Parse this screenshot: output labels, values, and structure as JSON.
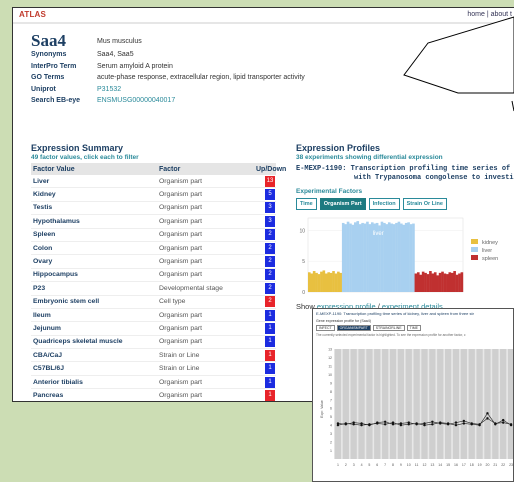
{
  "header": {
    "logo": "ATLAS",
    "nav": "home | about t"
  },
  "gene": {
    "name": "Saa4",
    "species": "Mus musculus",
    "props": [
      {
        "key": "Synonyms",
        "value": "Saa4, Saa5",
        "link": false
      },
      {
        "key": "InterPro Term",
        "value": "Serum amyloid A protein",
        "link": false
      },
      {
        "key": "GO Terms",
        "value": "acute-phase response, extracellular region, lipid transporter activity",
        "link": false
      },
      {
        "key": "Uniprot",
        "value": "P31532",
        "link": true
      },
      {
        "key": "Search EB-eye",
        "value": "ENSMUSG00000040017",
        "link": true
      }
    ]
  },
  "summary": {
    "title": "Expression Summary",
    "subtitle": "49 factor values, click each to filter",
    "headers": {
      "factor_value": "Factor Value",
      "factor": "Factor",
      "updown": "Up/Down"
    },
    "rows": [
      {
        "fv": "Liver",
        "factor": "Organism part",
        "count": "13",
        "dir": "up"
      },
      {
        "fv": "Kidney",
        "factor": "Organism part",
        "count": "5",
        "dir": "down"
      },
      {
        "fv": "Testis",
        "factor": "Organism part",
        "count": "3",
        "dir": "down"
      },
      {
        "fv": "Hypothalamus",
        "factor": "Organism part",
        "count": "3",
        "dir": "down"
      },
      {
        "fv": "Spleen",
        "factor": "Organism part",
        "count": "2",
        "dir": "down"
      },
      {
        "fv": "Colon",
        "factor": "Organism part",
        "count": "2",
        "dir": "down"
      },
      {
        "fv": "Ovary",
        "factor": "Organism part",
        "count": "2",
        "dir": "down"
      },
      {
        "fv": "Hippocampus",
        "factor": "Organism part",
        "count": "2",
        "dir": "down"
      },
      {
        "fv": "P23",
        "factor": "Developmental stage",
        "count": "2",
        "dir": "down"
      },
      {
        "fv": "Embryonic stem cell",
        "factor": "Cell type",
        "count": "2",
        "dir": "up"
      },
      {
        "fv": "Ileum",
        "factor": "Organism part",
        "count": "1",
        "dir": "down"
      },
      {
        "fv": "Jejunum",
        "factor": "Organism part",
        "count": "1",
        "dir": "down"
      },
      {
        "fv": "Quadriceps skeletal muscle",
        "factor": "Organism part",
        "count": "1",
        "dir": "down"
      },
      {
        "fv": "CBA/CaJ",
        "factor": "Strain or Line",
        "count": "1",
        "dir": "up"
      },
      {
        "fv": "C57BL/6J",
        "factor": "Strain or Line",
        "count": "1",
        "dir": "down"
      },
      {
        "fv": "Anterior tibialis",
        "factor": "Organism part",
        "count": "1",
        "dir": "down"
      },
      {
        "fv": "Pancreas",
        "factor": "Organism part",
        "count": "1",
        "dir": "up"
      }
    ]
  },
  "profiles": {
    "title": "Expression Profiles",
    "subtitle": "38 experiments showing differential expression",
    "experiment_line1": "E-MEXP-1190: Transcription profiling time series of kidney, liv",
    "experiment_line2": "with Trypanosoma congolense to investigate st",
    "factors_label": "Experimental Factors",
    "factor_buttons": [
      "Time",
      "Organism Part",
      "Infection",
      "Strain Or Line"
    ],
    "active_factor": "Organism Part",
    "show_prefix": "Show",
    "show_profile": "expression profile",
    "show_sep": "/",
    "show_details": "experiment details"
  },
  "chart_data": [
    {
      "type": "bar",
      "ylim": [
        0,
        12
      ],
      "yticks": [
        "0",
        "5",
        "10"
      ],
      "series": [
        {
          "name": "kidney",
          "color": "#e8c040",
          "range": [
            0,
            14
          ],
          "values": [
            3.2,
            3.0,
            3.4,
            3.1,
            2.9,
            3.3,
            3.5,
            3.0,
            3.2,
            3.1,
            3.4,
            3.0,
            3.3,
            3.1
          ]
        },
        {
          "name": "liver",
          "color": "#a8d0f0",
          "range": [
            14,
            44
          ],
          "values": [
            11.2,
            11.0,
            11.4,
            11.1,
            10.9,
            11.3,
            11.5,
            11.0,
            11.2,
            11.1,
            11.4,
            11.0,
            11.3,
            11.1,
            11.2,
            10.8,
            11.4,
            11.2,
            11.0,
            11.3,
            11.1,
            11.0,
            11.2,
            11.4,
            11.1,
            10.9,
            11.2,
            11.3,
            11.0,
            11.1
          ]
        },
        {
          "name": "spleen",
          "color": "#c03030",
          "range": [
            44,
            64
          ],
          "values": [
            3.0,
            3.2,
            2.8,
            3.3,
            3.1,
            2.9,
            3.4,
            3.0,
            3.2,
            2.7,
            3.1,
            3.3,
            3.0,
            2.9,
            3.2,
            3.1,
            3.4,
            2.8,
            3.0,
            3.2
          ]
        }
      ],
      "annotation": "liver"
    },
    {
      "type": "line",
      "title": "E-MEXP-1190: Transcription profiling time series of kidney, liver and spleen from three str",
      "subtitle": "Gene expression profile for (Saa4)",
      "tabs": [
        "INFECT",
        "ORGANISMPART",
        "STRAINORLINE",
        "TIME"
      ],
      "active_tab": "ORGANISMPART",
      "note": "The currently selected experimental factor is highlighted. To see the expression profile for another factor, c",
      "ylabel": "Expr. Value",
      "ylim": [
        0,
        13
      ],
      "yticks": [
        "13",
        "12",
        "11",
        "10",
        "9",
        "8",
        "7",
        "6",
        "5",
        "4",
        "3",
        "2",
        "1"
      ],
      "x": [
        "1",
        "2",
        "3",
        "4",
        "5",
        "6",
        "7",
        "8",
        "9",
        "10",
        "11",
        "12",
        "13",
        "14",
        "15",
        "16",
        "17",
        "18",
        "19",
        "20",
        "21",
        "22",
        "23"
      ],
      "series": [
        {
          "values": [
            4.2,
            4.1,
            4.3,
            4.2,
            4.0,
            4.3,
            4.4,
            4.1,
            4.2,
            4.3,
            4.1,
            4.2,
            4.4,
            4.2,
            4.1,
            4.3,
            4.5,
            4.2,
            4.1,
            4.8,
            4.2,
            4.3,
            4.1
          ]
        },
        {
          "values": [
            4.0,
            4.2,
            4.1,
            4.0,
            4.1,
            4.2,
            4.1,
            4.3,
            4.0,
            4.1,
            4.2,
            4.0,
            4.1,
            4.3,
            4.2,
            4.0,
            4.2,
            4.1,
            4.0,
            5.4,
            4.1,
            4.6,
            4.0
          ]
        }
      ]
    }
  ]
}
